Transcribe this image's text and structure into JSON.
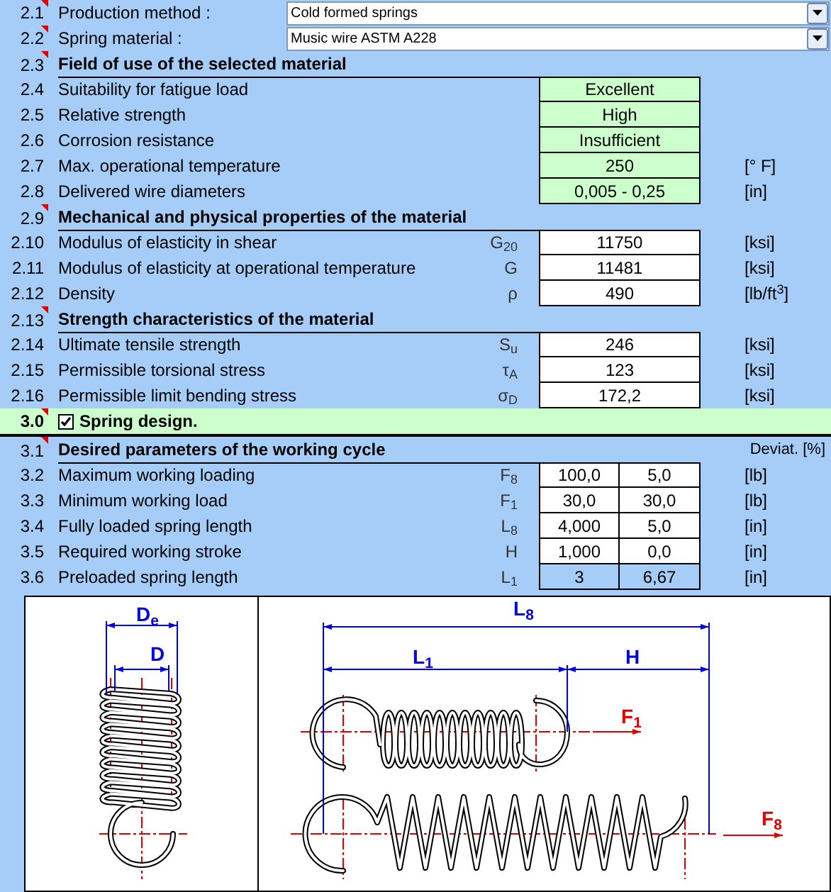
{
  "rows": [
    {
      "kind": "dropdown",
      "number": "2.1",
      "label": "Production method :",
      "value": "Cold formed springs",
      "comment": true
    },
    {
      "kind": "dropdown",
      "number": "2.2",
      "label": "Spring material :",
      "value": "Music wire ASTM A228",
      "comment": true
    },
    {
      "kind": "heading",
      "number": "2.3",
      "label": "Field of use of the selected material",
      "comment": true
    },
    {
      "kind": "info",
      "number": "2.4",
      "label": "Suitability for fatigue load",
      "value": "Excellent"
    },
    {
      "kind": "info",
      "number": "2.5",
      "label": "Relative strength",
      "value": "High"
    },
    {
      "kind": "info",
      "number": "2.6",
      "label": "Corrosion resistance",
      "value": "Insufficient"
    },
    {
      "kind": "info",
      "number": "2.7",
      "label": "Max. operational temperature",
      "value": "250",
      "unit": "[° F]"
    },
    {
      "kind": "info",
      "number": "2.8",
      "label": "Delivered wire diameters",
      "value": "0,005 - 0,25",
      "unit": "[in]"
    },
    {
      "kind": "heading",
      "number": "2.9",
      "label": "Mechanical and physical properties of the material",
      "comment": true
    },
    {
      "kind": "value",
      "number": "2.10",
      "label": "Modulus of elasticity in shear",
      "symbol": "G$_{20}$",
      "value": "11750",
      "unit": "[ksi]"
    },
    {
      "kind": "value",
      "number": "2.11",
      "label": "Modulus of elasticity at operational temperature",
      "symbol": "G",
      "value": "11481",
      "unit": "[ksi]"
    },
    {
      "kind": "value",
      "number": "2.12",
      "label": "Density",
      "symbol": "ρ",
      "value": "490",
      "unit": "[lb/ft$^{3}$]"
    },
    {
      "kind": "heading",
      "number": "2.13",
      "label": "Strength characteristics of the material",
      "comment": true
    },
    {
      "kind": "value",
      "number": "2.14",
      "label": "Ultimate tensile strength",
      "symbol": "S$_{u}$",
      "value": "246",
      "unit": "[ksi]"
    },
    {
      "kind": "value",
      "number": "2.15",
      "label": "Permissible torsional stress",
      "symbol": "τ$_{A}$",
      "value": "123",
      "unit": "[ksi]"
    },
    {
      "kind": "value",
      "number": "2.16",
      "label": "Permissible limit bending stress",
      "symbol": "σ$_{D}$",
      "value": "172,2",
      "unit": "[ksi]"
    },
    {
      "kind": "section",
      "number": "3.0",
      "label": "Spring design.",
      "checked": true,
      "comment": true
    },
    {
      "kind": "heading",
      "number": "3.1",
      "label": "Desired parameters of the working cycle",
      "extra": "Deviat. [%]",
      "comment": true
    },
    {
      "kind": "pair",
      "number": "3.2",
      "label": "Maximum working loading",
      "symbol": "F$_{8}$",
      "value": "100,0",
      "deviation": "5,0",
      "unit": "[lb]",
      "editable": true
    },
    {
      "kind": "pair",
      "number": "3.3",
      "label": "Minimum working load",
      "symbol": "F$_{1}$",
      "value": "30,0",
      "deviation": "30,0",
      "unit": "[lb]",
      "editable": true
    },
    {
      "kind": "pair",
      "number": "3.4",
      "label": "Fully loaded spring length",
      "symbol": "L$_{8}$",
      "value": "4,000",
      "deviation": "5,0",
      "unit": "[in]",
      "editable": true
    },
    {
      "kind": "pair",
      "number": "3.5",
      "label": "Required working stroke",
      "symbol": "H",
      "value": "1,000",
      "deviation": "0,0",
      "unit": "[in]",
      "editable": true
    },
    {
      "kind": "pair",
      "number": "3.6",
      "label": "Preloaded spring length",
      "symbol": "L$_{1}$",
      "value": "3",
      "deviation": "6,67",
      "unit": "[in]",
      "editable": false
    }
  ],
  "drawing": {
    "labels": [
      "D$_{e}$",
      "D",
      "L$_{8}$",
      "L$_{1}$",
      "H",
      "F$_{1}$",
      "F$_{8}$"
    ]
  }
}
